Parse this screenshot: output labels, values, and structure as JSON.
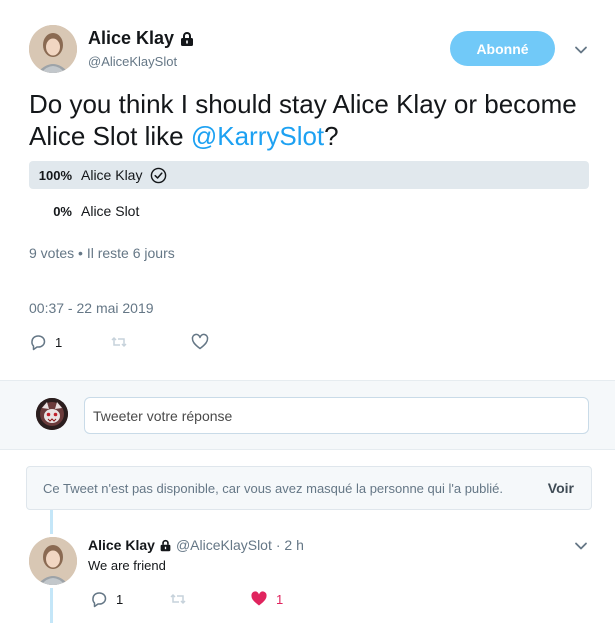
{
  "tweet": {
    "display_name": "Alice Klay",
    "handle": "@AliceKlaySlot",
    "follow_label": "Abonné",
    "text_before": "Do you think I should stay  Alice Klay or become Alice Slot like ",
    "mention": "@KarrySlot",
    "text_after": "?",
    "poll": {
      "options": [
        {
          "percent": "100%",
          "label": "Alice Klay",
          "winner": true
        },
        {
          "percent": "0%",
          "label": "Alice Slot",
          "winner": false
        }
      ],
      "meta": "9 votes • Il reste 6 jours"
    },
    "timestamp": "00:37 - 22 mai 2019",
    "actions": {
      "reply_count": "1",
      "retweet_count": "",
      "like_count": ""
    }
  },
  "reply_box": {
    "placeholder": "Tweeter votre réponse"
  },
  "unavailable_notice": {
    "text": "Ce Tweet n'est pas disponible, car vous avez masqué la personne qui l'a publié.",
    "link_label": "Voir"
  },
  "reply": {
    "display_name": "Alice Klay",
    "handle": "@AliceKlaySlot",
    "time": "· 2 h",
    "text": "We are friend",
    "reply_count": "1",
    "like_count": "1"
  },
  "colors": {
    "accent": "#1da1f2",
    "follow_button": "#71c9f8",
    "like_active": "#e0245e",
    "muted_text": "#657786"
  },
  "icons": {
    "lock": "lock-icon",
    "caret": "chevron-down-icon",
    "check": "check-circle-icon",
    "reply": "reply-icon",
    "retweet": "retweet-icon",
    "like": "heart-icon"
  }
}
